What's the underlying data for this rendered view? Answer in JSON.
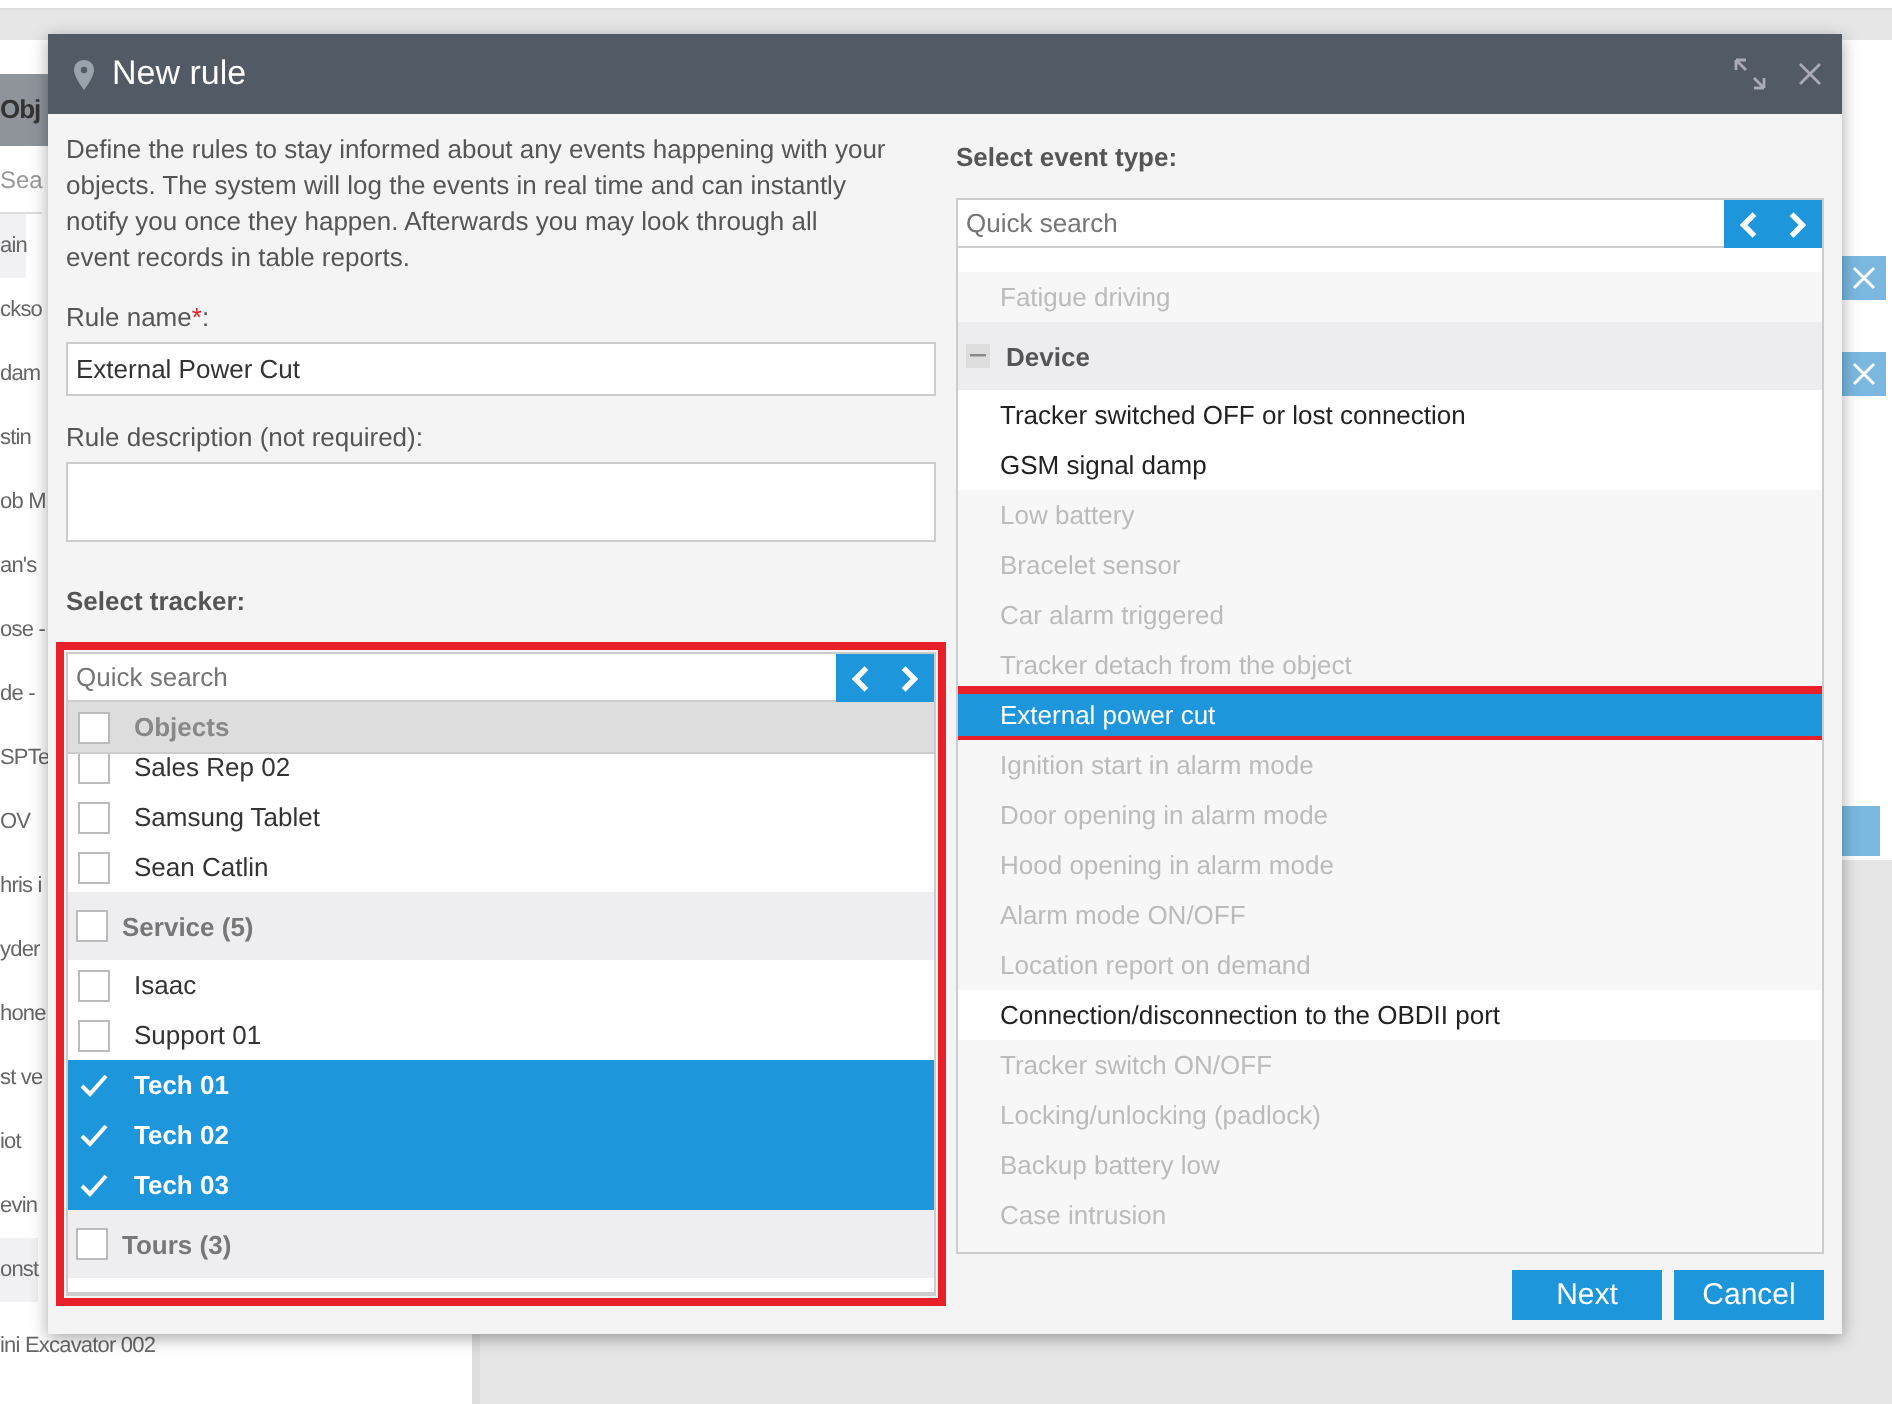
{
  "background": {
    "sidebar": {
      "header": "Obj",
      "search": {
        "placeholder": "Sea"
      },
      "rows": [
        {
          "kind": "group",
          "label": "ain"
        },
        {
          "kind": "item",
          "label": "ckso"
        },
        {
          "kind": "item",
          "label": "dam"
        },
        {
          "kind": "item",
          "label": "stin"
        },
        {
          "kind": "item",
          "label": "ob M"
        },
        {
          "kind": "item",
          "label": "an's"
        },
        {
          "kind": "item",
          "label": "ose -"
        },
        {
          "kind": "item",
          "label": "de -"
        },
        {
          "kind": "item",
          "label": "SPTe"
        },
        {
          "kind": "item",
          "label": "OV"
        },
        {
          "kind": "item",
          "label": "hris i"
        },
        {
          "kind": "item",
          "label": "yder"
        },
        {
          "kind": "item",
          "label": "hone"
        },
        {
          "kind": "item",
          "label": "st ve"
        },
        {
          "kind": "item",
          "label": "iot"
        },
        {
          "kind": "item",
          "label": "evin"
        },
        {
          "kind": "group",
          "label": "onst"
        },
        {
          "kind": "item",
          "label": "ini Excavator 002"
        }
      ]
    }
  },
  "dialog": {
    "title": "New rule",
    "intro": "Define the rules to stay informed about any events happening with your objects. The system will log the events in real time and can instantly notify you once they happen. Afterwards you may look through all event records in table reports.",
    "rule_name": {
      "label": "Rule name",
      "required_mark": "*",
      "colon": ":",
      "value": "External Power Cut"
    },
    "rule_description": {
      "label": "Rule description (not required):"
    },
    "tracker": {
      "label": "Select tracker:",
      "highlighted": true,
      "search": {
        "placeholder": "Quick search"
      },
      "header": {
        "label": "Objects",
        "checked": false
      },
      "items": [
        {
          "kind": "item",
          "label": "Sales Rep 02",
          "checked": false
        },
        {
          "kind": "item",
          "label": "Samsung Tablet",
          "checked": false
        },
        {
          "kind": "item",
          "label": "Sean Catlin",
          "checked": false
        },
        {
          "kind": "group",
          "label": "Service (5)",
          "checked": false
        },
        {
          "kind": "item",
          "label": "Isaac",
          "checked": false
        },
        {
          "kind": "item",
          "label": "Support 01",
          "checked": false
        },
        {
          "kind": "item",
          "label": "Tech 01",
          "checked": true
        },
        {
          "kind": "item",
          "label": "Tech 02",
          "checked": true
        },
        {
          "kind": "item",
          "label": "Tech 03",
          "checked": true
        },
        {
          "kind": "group",
          "label": "Tours (3)",
          "checked": false
        }
      ]
    },
    "event_type": {
      "label": "Select event type:",
      "search": {
        "placeholder": "Quick search"
      },
      "items": [
        {
          "kind": "item",
          "label": "Fatigue driving",
          "enabled": false,
          "selected": false,
          "highlighted": false
        },
        {
          "kind": "group",
          "label": "Device",
          "expanded": true
        },
        {
          "kind": "item",
          "label": "Tracker switched OFF or lost connection",
          "enabled": true,
          "selected": false,
          "highlighted": false
        },
        {
          "kind": "item",
          "label": "GSM signal damp",
          "enabled": true,
          "selected": false,
          "highlighted": false
        },
        {
          "kind": "item",
          "label": "Low battery",
          "enabled": false,
          "selected": false,
          "highlighted": false
        },
        {
          "kind": "item",
          "label": "Bracelet sensor",
          "enabled": false,
          "selected": false,
          "highlighted": false
        },
        {
          "kind": "item",
          "label": "Car alarm triggered",
          "enabled": false,
          "selected": false,
          "highlighted": false
        },
        {
          "kind": "item",
          "label": "Tracker detach from the object",
          "enabled": false,
          "selected": false,
          "highlighted": false
        },
        {
          "kind": "item",
          "label": "External power cut",
          "enabled": true,
          "selected": true,
          "highlighted": true
        },
        {
          "kind": "item",
          "label": "Ignition start in alarm mode",
          "enabled": false,
          "selected": false,
          "highlighted": false
        },
        {
          "kind": "item",
          "label": "Door opening in alarm mode",
          "enabled": false,
          "selected": false,
          "highlighted": false
        },
        {
          "kind": "item",
          "label": "Hood opening in alarm mode",
          "enabled": false,
          "selected": false,
          "highlighted": false
        },
        {
          "kind": "item",
          "label": "Alarm mode ON/OFF",
          "enabled": false,
          "selected": false,
          "highlighted": false
        },
        {
          "kind": "item",
          "label": "Location report on demand",
          "enabled": false,
          "selected": false,
          "highlighted": false
        },
        {
          "kind": "item",
          "label": "Connection/disconnection to the OBDII port",
          "enabled": true,
          "selected": false,
          "highlighted": false
        },
        {
          "kind": "item",
          "label": "Tracker switch ON/OFF",
          "enabled": false,
          "selected": false,
          "highlighted": false
        },
        {
          "kind": "item",
          "label": "Locking/unlocking (padlock)",
          "enabled": false,
          "selected": false,
          "highlighted": false
        },
        {
          "kind": "item",
          "label": "Backup battery low",
          "enabled": false,
          "selected": false,
          "highlighted": false
        },
        {
          "kind": "item",
          "label": "Case intrusion",
          "enabled": false,
          "selected": false,
          "highlighted": false
        }
      ]
    },
    "buttons": [
      "Next",
      "Cancel"
    ]
  }
}
